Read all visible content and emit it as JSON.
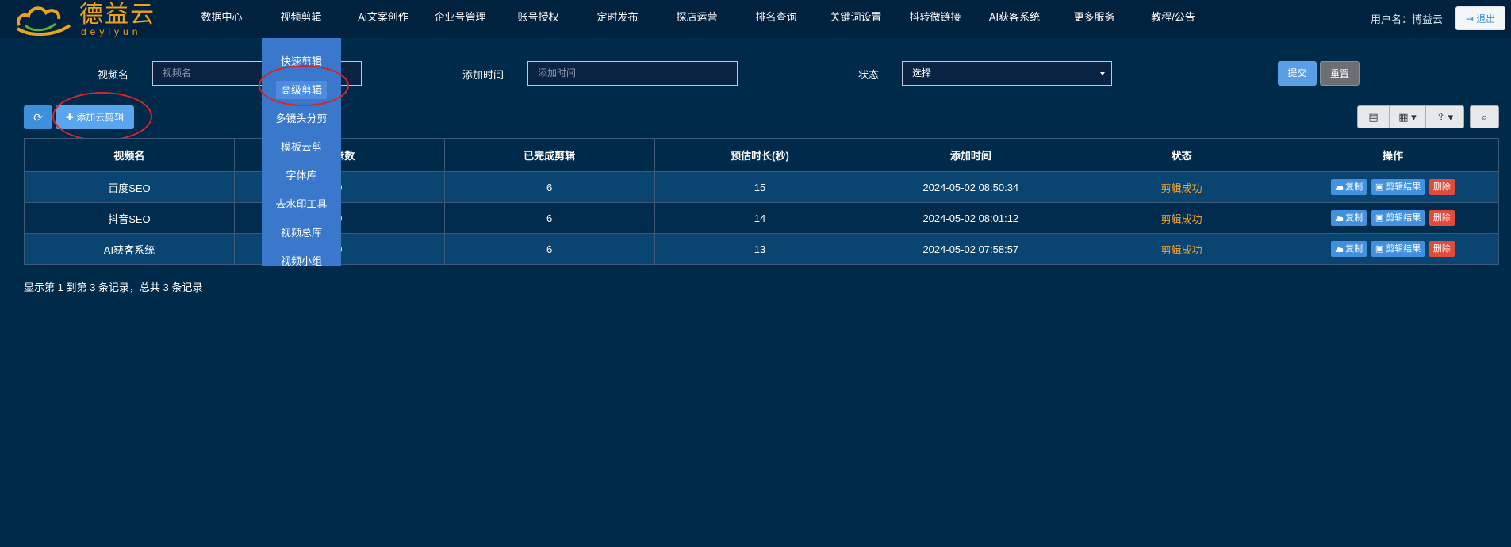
{
  "brand": {
    "name": "德益云",
    "sub": "deyiyun"
  },
  "nav": [
    {
      "label": "数据中心",
      "name": "nav-data-center"
    },
    {
      "label": "视频剪辑",
      "name": "nav-video-edit"
    },
    {
      "label": "Ai文案创作",
      "name": "nav-ai-copywriting"
    },
    {
      "label": "企业号管理",
      "name": "nav-enterprise-account"
    },
    {
      "label": "账号授权",
      "name": "nav-account-auth"
    },
    {
      "label": "定时发布",
      "name": "nav-scheduled-publish"
    },
    {
      "label": "探店运营",
      "name": "nav-store-visit"
    },
    {
      "label": "排名查询",
      "name": "nav-ranking"
    },
    {
      "label": "关键词设置",
      "name": "nav-keywords"
    },
    {
      "label": "抖转微链接",
      "name": "nav-dy-wechat-link"
    },
    {
      "label": "AI获客系统",
      "name": "nav-ai-customer"
    },
    {
      "label": "更多服务",
      "name": "nav-more"
    },
    {
      "label": "教程/公告",
      "name": "nav-tutorial"
    }
  ],
  "user": {
    "label": "用户名：博益云",
    "logout": "退出"
  },
  "filters": {
    "name_label": "视频名",
    "name_placeholder": "视频名",
    "time_label": "添加时间",
    "time_placeholder": "添加时间",
    "status_label": "状态",
    "status_value": "选择",
    "submit": "提交",
    "reset": "重置"
  },
  "toolbar": {
    "add_label": "添加云剪辑"
  },
  "dropdown": [
    "快速剪辑",
    "高级剪辑",
    "多镜头分剪",
    "模板云剪",
    "字体库",
    "去水印工具",
    "视频总库",
    "视频小组"
  ],
  "table": {
    "headers": [
      "视频名",
      "剪辑数",
      "已完成剪辑",
      "预估时长(秒)",
      "添加时间",
      "状态",
      "操作"
    ],
    "rows": [
      {
        "name": "百度SEO",
        "count": "0",
        "done": "6",
        "duration": "15",
        "time": "2024-05-02 08:50:34",
        "status": "剪辑成功"
      },
      {
        "name": "抖音SEO",
        "count": "0",
        "done": "6",
        "duration": "14",
        "time": "2024-05-02 08:01:12",
        "status": "剪辑成功"
      },
      {
        "name": "AI获客系统",
        "count": "0",
        "done": "6",
        "duration": "13",
        "time": "2024-05-02 07:58:57",
        "status": "剪辑成功"
      }
    ],
    "actions": {
      "copy": "复制",
      "result": "剪辑结果",
      "delete": "删除"
    }
  },
  "footer": "显示第 1 到第 3 条记录，总共 3 条记录",
  "colors": {
    "background": "#002a4a",
    "accent": "#3a78cc",
    "status": "#f0a02c",
    "danger": "#e04c3c",
    "highlight_circle": "#d9232c"
  }
}
